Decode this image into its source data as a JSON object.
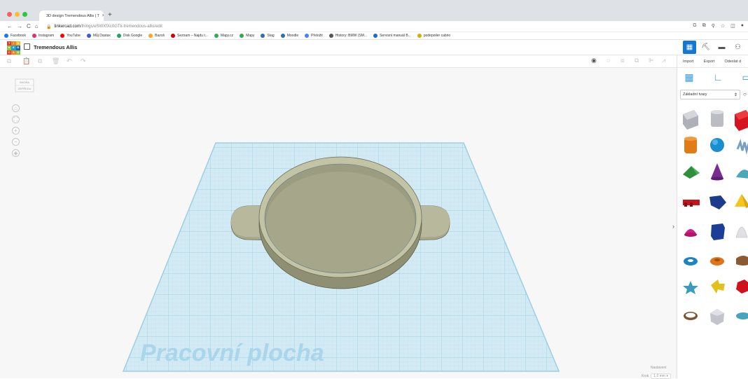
{
  "browser": {
    "tab_title": "3D design Tremendous Allis | T",
    "url_host": "tinkercad.com",
    "url_path": "/things/eSWXfXc0GTk-tremendous-allis/edit",
    "bookmarks": [
      {
        "label": "Facebook",
        "color": "#1877f2"
      },
      {
        "label": "Instagram",
        "color": "#e1306c"
      },
      {
        "label": "YouTube",
        "color": "#ff0000"
      },
      {
        "label": "Můj Dastax",
        "color": "#3a5bd9"
      },
      {
        "label": "Disk Google",
        "color": "#1fa463"
      },
      {
        "label": "Bazoš",
        "color": "#f6a623"
      },
      {
        "label": "Seznam – Najdu t...",
        "color": "#cc0000"
      },
      {
        "label": "Mapy.cz",
        "color": "#37a657"
      },
      {
        "label": "Mapy",
        "color": "#34a853"
      },
      {
        "label": "Stag",
        "color": "#2b6fb5"
      },
      {
        "label": "Moodle",
        "color": "#2b6fb5"
      },
      {
        "label": "Přeložit",
        "color": "#4285f4"
      },
      {
        "label": "History: BMW (SM...",
        "color": "#555555"
      },
      {
        "label": "Servisní manuál B...",
        "color": "#1c69d4"
      },
      {
        "label": "podepoiler cabrio",
        "color": "#d6b000"
      }
    ]
  },
  "app": {
    "logo_letters": [
      "T",
      "I",
      "N",
      "K",
      "E",
      "R",
      "C",
      "A",
      "D"
    ],
    "logo_colors": [
      "#e23d28",
      "#f58220",
      "#fcb918",
      "#8dc63f",
      "#15a4d6",
      "#1c68b2",
      "#e23d28",
      "#f58220",
      "#8dc63f"
    ],
    "design_title": "Tremendous Allis",
    "actions": {
      "import": "Import",
      "export": "Export",
      "send": "Odeslat d"
    },
    "shapes_select": "Základní tvary",
    "workplane_label": "Pracovní plocha",
    "settings_label": "Nastavení",
    "step_label": "Krok",
    "step_value": "1,0 mm ▾",
    "navcube_top": "SHORA",
    "navcube_front": "ZEPŘEDU",
    "accent": "#1477d1"
  }
}
